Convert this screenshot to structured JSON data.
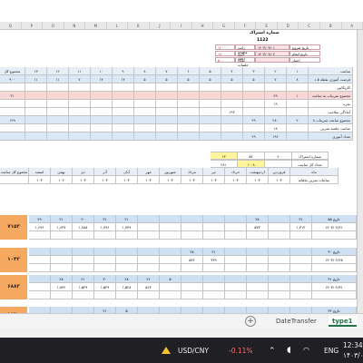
{
  "column_letters": [
    "Q",
    "P",
    "O",
    "N",
    "M",
    "L",
    "K",
    "J",
    "I",
    "H",
    "G",
    "F",
    "E",
    "D",
    "C",
    "B",
    "A"
  ],
  "info": {
    "title": "شماره اشتراک",
    "subtitle": "1122",
    "rows": [
      {
        "label": "تاریخ شروع",
        "value": "۱۴۰۳/۰۳/۰۱",
        "k2": "راتب ماهیانه",
        "v2": "۱۲۰۰۰"
      },
      {
        "label": "تاریخ اتمام",
        "value": "۱۴۰۳/۰۴/۰۲",
        "k2": "تاریخ اعلام",
        "v2": "۱۷۰۰"
      },
      {
        "label": "اعتبار",
        "value": "",
        "k2": "تعداد جلسات",
        "v2": "۵۰۰"
      }
    ]
  },
  "main_table": {
    "header": [
      "مجموع کل",
      "۱۳",
      "۱۲",
      "۱۱",
      "۱۰",
      "۹",
      "۸",
      "۷",
      "۶",
      "۵",
      "۴",
      "۳",
      "۲",
      "۱",
      "ساعت"
    ],
    "rows": [
      {
        "label": "فرصت آموزی نقطه ۵ د",
        "cells": [
          "۹۰۰",
          "۱۱",
          "۱۱",
          "۷",
          "۱۴",
          "۱۴",
          "۵",
          "۵",
          "۵",
          "۵",
          "۵",
          "۵",
          "۷",
          "۸",
          "۷"
        ],
        "color": "#dbe8f5"
      },
      {
        "label": "کاریکاتور",
        "cells": [
          "",
          "",
          "",
          "",
          "",
          "",
          "",
          "",
          "",
          "",
          "",
          "",
          "",
          "",
          ""
        ],
        "color": "#ffffff"
      },
      {
        "label": "مجموع تمرینات به ساعت",
        "cells": [
          "۳۱",
          "",
          "",
          "",
          "",
          "",
          "",
          "",
          "",
          "",
          "",
          "",
          "۲۹",
          "۱",
          ""
        ],
        "color": "#f8d7d7"
      },
      {
        "label": "نمره",
        "cells": [
          "",
          "",
          "",
          "",
          "",
          "",
          "",
          "",
          "",
          "",
          "",
          "",
          "۱۹",
          "",
          ""
        ],
        "color": "#ffffff"
      },
      {
        "label": "آمادگی سلامت",
        "cells": [
          "",
          "",
          "",
          "",
          "",
          "",
          "",
          "",
          "",
          "",
          "۱۹۳",
          "",
          "",
          "",
          ""
        ],
        "color": "#ffffff"
      },
      {
        "label": "مجموع ساعت تمرینات ۸ ساعت",
        "cells": [
          "۱۹۹",
          "",
          "",
          "",
          "",
          "",
          "",
          "",
          "",
          "",
          "",
          "۲۹",
          "۲۸۰",
          "۲",
          ""
        ],
        "color": "#dbe8f5"
      },
      {
        "label": "ساعت جلسه تمرین",
        "cells": [
          "",
          "",
          "",
          "",
          "",
          "",
          "",
          "",
          "",
          "",
          "",
          "",
          "۱۸",
          "",
          ""
        ],
        "color": "#ffffff"
      },
      {
        "label": "تعداد آموزی",
        "cells": [
          "",
          "",
          "",
          "",
          "",
          "",
          "",
          "",
          "",
          "",
          "",
          "۲۹",
          "۱۹۲",
          "",
          ""
        ],
        "color": "#dbe8f5"
      }
    ]
  },
  "summary": {
    "rows": [
      {
        "a": "۱۳",
        "b": "۵۴",
        "c": "۴",
        "label": "شماره اشتراک"
      },
      {
        "a": "۲۸۱",
        "b": "۱۰۰۸",
        "c": "",
        "label": "تعداد کل ساعت"
      }
    ]
  },
  "months_header": [
    "مجموع کل ساعت ماهانه",
    "اسفند",
    "بهمن",
    "دی",
    "آذر",
    "آبان",
    "مهر",
    "شهریور",
    "مرداد",
    "تیر",
    "خرداد",
    "اردیبهشت",
    "فروردین",
    "ماه"
  ],
  "months_row": [
    "",
    "۱۰۳",
    "۱۰۴",
    "۱۰۳",
    "۱۰۳",
    "۱۰۳",
    "۱۰۳",
    "۱۰۳",
    "۱۰۳",
    "۱۰۳",
    "۱۰۳",
    "۱۰۳",
    "۱۰۳",
    "ساعات تمرین ماهانه"
  ],
  "blocks": [
    {
      "total": "۷۱۵۳",
      "rows": [
        {
          "cells": [
            "۲۹",
            "۲۱",
            "۲۰",
            "۳۱",
            "۲۱",
            "",
            "",
            "",
            "",
            "",
            "۲۸",
            "",
            "۳۱",
            "۵۵ تاریخ"
          ],
          "color": "#cfe0f3"
        },
        {
          "cells": [
            "۱,۶۹۶",
            "۱,۶۴۷",
            "۱,۷۸۸",
            "۱,۷۹۶",
            "۱,۷۴۹",
            "",
            "",
            "",
            "",
            "",
            "۵۲۳",
            "",
            "۱,۳۱۲",
            "۱۴۰۳/۰۲/۲۱"
          ],
          "color": "#ffffff"
        },
        {
          "cells": [
            "",
            "",
            "",
            "",
            "",
            "",
            "",
            "",
            "",
            "",
            "",
            "",
            "",
            ""
          ],
          "color": "#ffffff"
        }
      ]
    },
    {
      "total": "۱۰۴۳",
      "rows": [
        {
          "cells": [
            "",
            "",
            "",
            "",
            "",
            "",
            "",
            "۲۸",
            "۲۱",
            "",
            "",
            "",
            "",
            "۳۰ تاریخ"
          ],
          "color": "#cfe0f3"
        },
        {
          "cells": [
            "",
            "",
            "",
            "",
            "",
            "",
            "",
            "۵۲۶",
            "۳۲۹",
            "",
            "",
            "",
            "",
            "۱۴۰۳/۰۲/۲۸"
          ],
          "color": "#ffffff"
        },
        {
          "cells": [
            "",
            "",
            "",
            "",
            "",
            "",
            "",
            "",
            "",
            "",
            "",
            "",
            "",
            ""
          ],
          "color": "#ffffff"
        }
      ]
    },
    {
      "total": "۶۸۸۳",
      "rows": [
        {
          "cells": [
            "",
            "۲۸",
            "۲۱",
            "۳۰",
            "۲۸",
            "۲۶",
            "۵",
            "",
            "",
            "",
            "",
            "",
            "",
            "۳۱ تاریخ"
          ],
          "color": "#cfe0f3"
        },
        {
          "cells": [
            "",
            "۱,۸۴۲",
            "۱,۵۲۹",
            "۱,۵۲۹",
            "۱,۵۲۸",
            "۵۱۳",
            "",
            "",
            "",
            "",
            "",
            "",
            "",
            "۱۴۰۳/۰۲/۳۱"
          ],
          "color": "#ffffff"
        },
        {
          "cells": [
            "",
            "",
            "",
            "",
            "",
            "",
            "",
            "",
            "",
            "",
            "",
            "",
            "",
            ""
          ],
          "color": "#ffffff"
        }
      ]
    },
    {
      "total": "۱۸۴۰",
      "rows": [
        {
          "cells": [
            "",
            "",
            "",
            "۲۱",
            "۵",
            "",
            "",
            "",
            "",
            "",
            "",
            "",
            "",
            "۳۲ تاریخ"
          ],
          "color": "#cfe0f3"
        },
        {
          "cells": [
            "",
            "",
            "",
            "۱,۷۷۸",
            "۱۱۳",
            "",
            "",
            "",
            "",
            "",
            "",
            "",
            "",
            "۱۴۰۳/۰۲/۳۲"
          ],
          "color": "#ffffff"
        }
      ]
    }
  ],
  "sheet_tabs": {
    "add_label": "+",
    "tabs": [
      "DateTransfer",
      "type1"
    ],
    "active": "type1"
  },
  "taskbar": {
    "ticker": "USD/CNY",
    "change": "-0.11%",
    "lang": "ENG",
    "time": "12:34",
    "date": "۱۴۰۳/۰"
  }
}
